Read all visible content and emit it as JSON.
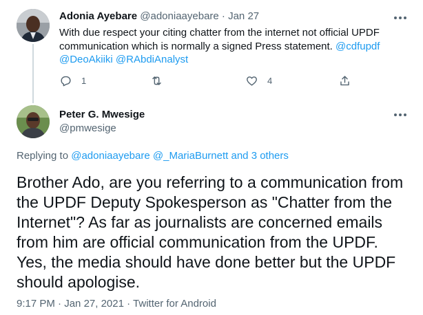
{
  "parent_tweet": {
    "author_name": "Adonia Ayebare",
    "author_handle": "@adoniaayebare",
    "separator": "·",
    "date": "Jan 27",
    "text": "With due respect your citing chatter from the internet not official UPDF communication which is normally a signed Press statement.",
    "mentions": [
      "@cdfupdf",
      "@DeoAkiiki",
      "@RAbdiAnalyst"
    ],
    "actions": {
      "reply_count": "1",
      "retweet_count": "",
      "like_count": "4"
    },
    "icons": [
      "reply-icon",
      "retweet-icon",
      "like-icon",
      "share-icon",
      "more-icon"
    ]
  },
  "main_tweet": {
    "author_name": "Peter G. Mwesige",
    "author_handle": "@pmwesige",
    "replying_prefix": "Replying to",
    "replying_users": [
      "@adoniaayebare",
      "@_MariaBurnett"
    ],
    "replying_others": "and 3 others",
    "text": "Brother Ado, are you referring to a communication from the UPDF Deputy Spokesperson as \"Chatter from the Internet\"? As far as journalists are concerned emails from him are official communication from the UPDF. Yes, the media should have done better but the UPDF should apologise.",
    "time": "9:17 PM",
    "separator": "·",
    "date": "Jan 27, 2021",
    "source": "Twitter for Android"
  },
  "colors": {
    "link": "#1d9bf0",
    "muted": "#536471",
    "text": "#0f1419",
    "thread_line": "#cfd9de"
  }
}
